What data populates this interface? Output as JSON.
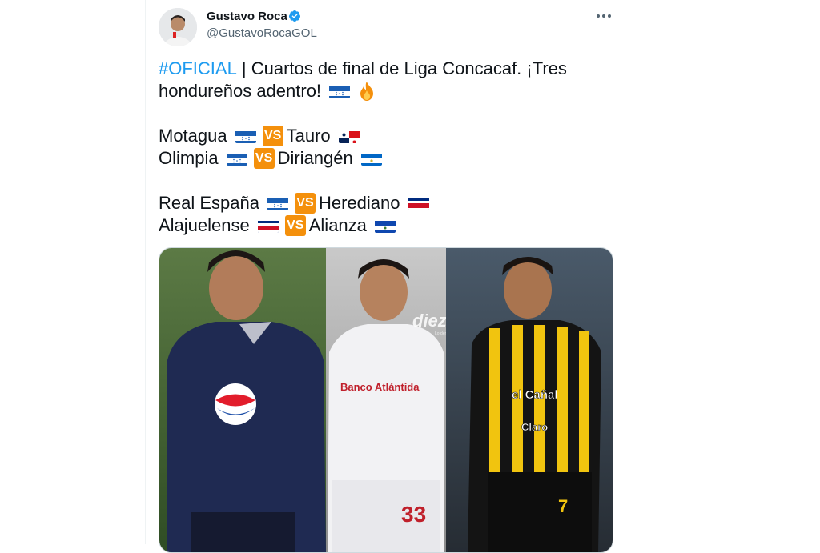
{
  "tweet": {
    "author_name": "Gustavo Roca",
    "author_handle": "@GustavoRocaGOL",
    "more_label": "More",
    "hashtag": "#OFICIAL",
    "headline_rest": " | Cuartos de final de Liga Concacaf. ¡Tres",
    "headline_line2": "hondureños adentro!",
    "vs_label": "VS",
    "matches": [
      {
        "home": "Motagua",
        "home_flag": "honduras",
        "away": "Tauro",
        "away_flag": "panama"
      },
      {
        "home": "Olimpia",
        "home_flag": "honduras",
        "away": "Diriangén",
        "away_flag": "nicaragua"
      },
      {
        "home": "Real España",
        "home_flag": "honduras",
        "away": "Herediano",
        "away_flag": "costa-rica"
      },
      {
        "home": "Alajuelense",
        "home_flag": "costa-rica",
        "away": "Alianza",
        "away_flag": "el-salvador"
      }
    ],
    "image": {
      "watermark": "diez.hn",
      "watermark_tagline": "Lo demás todo por la pasión",
      "sponsors": [
        "Banco Atlántida",
        "el Cañal",
        "Claro"
      ],
      "shirt_number_center": "33",
      "shirt_number_right": "7"
    }
  },
  "colors": {
    "link": "#1d9bf0",
    "text": "#0f1419",
    "secondary": "#536471",
    "vs_bg": "#f4900c"
  }
}
